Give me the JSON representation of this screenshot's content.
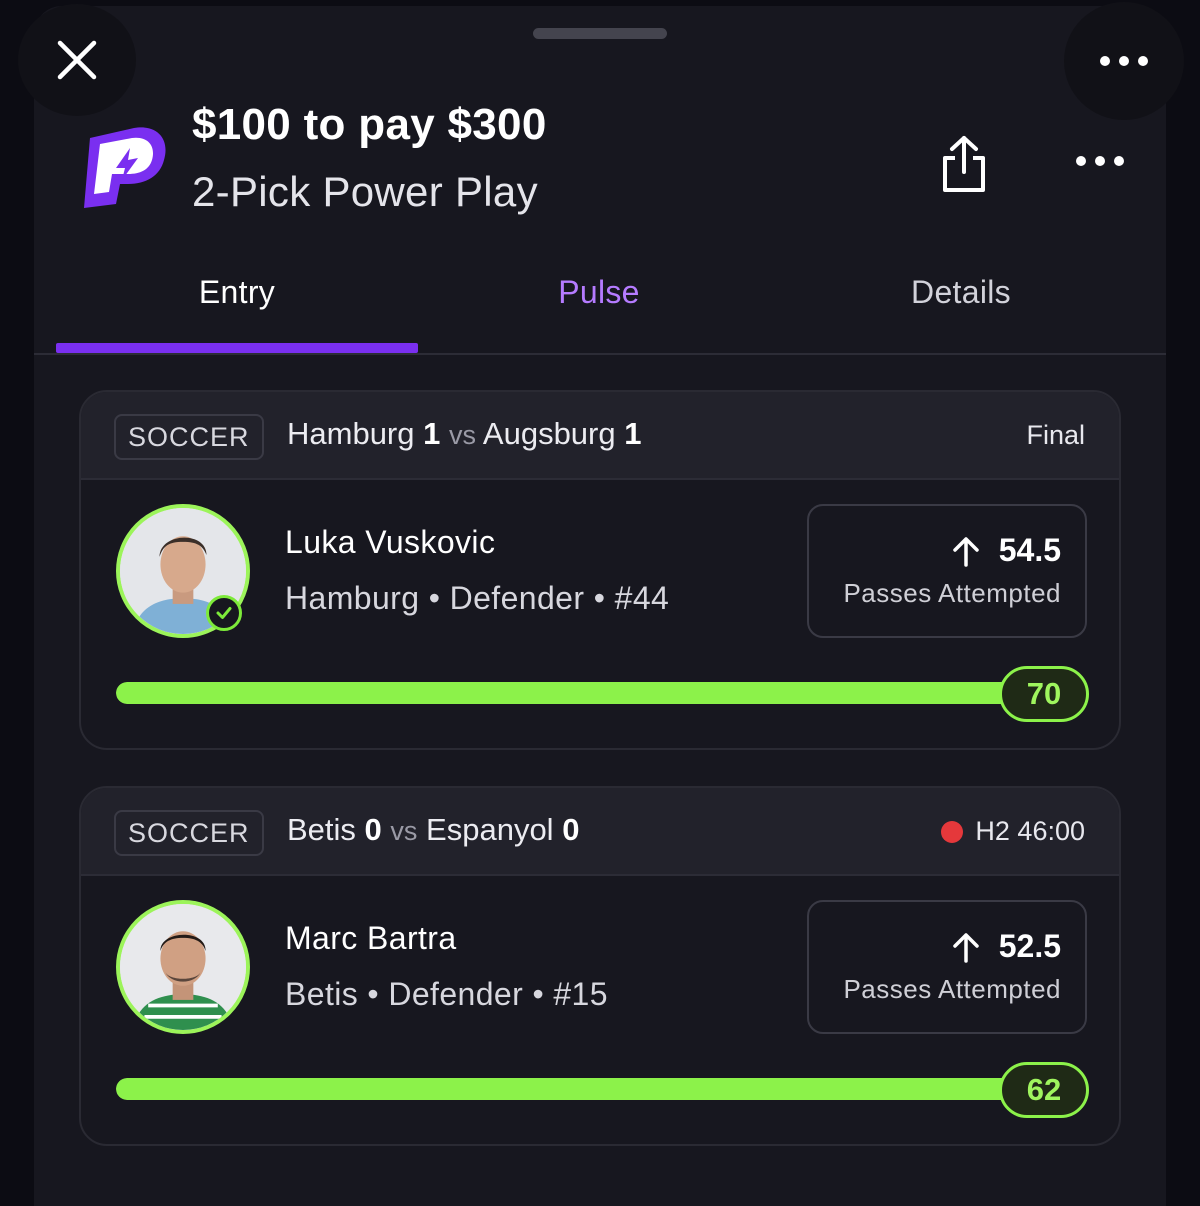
{
  "header": {
    "title": "$100 to pay $300",
    "subtitle": "2-Pick Power Play"
  },
  "tabs": [
    {
      "label": "Entry",
      "active": true
    },
    {
      "label": "Pulse"
    },
    {
      "label": "Details"
    }
  ],
  "picks": [
    {
      "sport": "SOCCER",
      "home_team": "Hamburg",
      "home_score": "1",
      "vs": "vs",
      "away_team": "Augsburg",
      "away_score": "1",
      "status": "Final",
      "player_name": "Luka Vuskovic",
      "player_info": "Hamburg • Defender • #44",
      "line": "54.5",
      "direction": "more",
      "stat": "Passes Attempted",
      "actual": "70",
      "progress_fraction": 1.0
    },
    {
      "sport": "SOCCER",
      "home_team": "Betis",
      "home_score": "0",
      "vs": "vs",
      "away_team": "Espanyol",
      "away_score": "0",
      "status": "H2 46:00",
      "player_name": "Marc Bartra",
      "player_info": "Betis • Defender • #15",
      "line": "52.5",
      "direction": "more",
      "stat": "Passes Attempted",
      "actual": "62",
      "progress_fraction": 1.0
    }
  ],
  "colors": {
    "accent_purple": "#7a2ff0",
    "pulse_purple": "#b57bff",
    "progress_green": "#8cf24a",
    "live_red": "#e5383b",
    "background": "#17171f"
  },
  "icons": {
    "close": "close-icon",
    "more": "more-horizontal-icon",
    "share": "share-icon",
    "arrow_up": "arrow-up-icon",
    "check": "check-circle-icon",
    "live": "live-dot-icon",
    "logo": "prizepicks-logo"
  }
}
